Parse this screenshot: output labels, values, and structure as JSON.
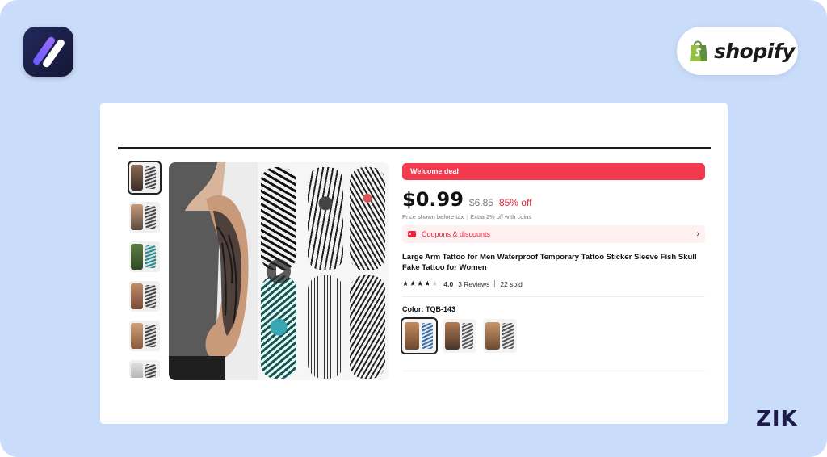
{
  "brand": {
    "shopify_text": "shopify",
    "corner_text": "ZIK",
    "app_logo_icon": "slash-logo-icon",
    "shopify_icon": "shopify-bag-icon"
  },
  "gallery": {
    "thumbnail_count": 6,
    "selected_index": 0,
    "play_icon": "play-icon"
  },
  "product": {
    "deal_label": "Welcome deal",
    "price": "$0.99",
    "old_price": "$6.85",
    "discount": "85% off",
    "tax_note": "Price shown before tax",
    "coins_note": "Extra 2% off with coins",
    "coupons_label": "Coupons & discounts",
    "title": "Large Arm Tattoo for Men Waterproof Temporary Tattoo Sticker Sleeve Fish Skull Fake Tattoo for Women",
    "rating": "4.0",
    "stars_filled": 4,
    "stars_total": 5,
    "reviews": "3 Reviews",
    "sold": "22 sold",
    "color_label": "Color: TQB-143",
    "swatch_count": 3,
    "selected_swatch": 0
  },
  "colors": {
    "background": "#c9dcfa",
    "accent_red": "#f23a4f",
    "coupon_bg": "#fff0f1",
    "shopify_green": "#95bf47"
  }
}
